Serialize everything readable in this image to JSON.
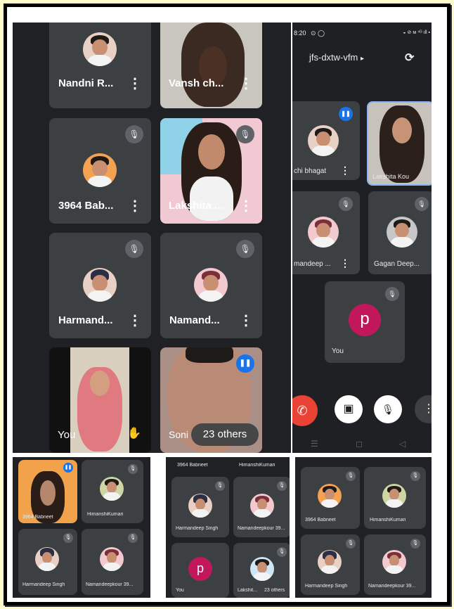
{
  "main": {
    "tiles": [
      {
        "name": "Nandni R...",
        "muted": false
      },
      {
        "name": "Vansh ch...",
        "muted": false
      },
      {
        "name": "3964 Bab...",
        "muted": true
      },
      {
        "name": "Lakshita ...",
        "muted": true
      },
      {
        "name": "Harmand...",
        "muted": true
      },
      {
        "name": "Namand...",
        "muted": true
      },
      {
        "name": "You",
        "muted": false
      },
      {
        "name": "Soni",
        "muted": false
      }
    ],
    "others_label": "23 others",
    "menu_glyph": "⋮",
    "mic_off_glyph": "🎙",
    "talk_glyph": "❚❚",
    "raise_hand_glyph": "✋"
  },
  "phone": {
    "status": {
      "time": "8:20",
      "icons_left": "⊙ ◯",
      "icons_right": "◒ ⊘ ᴍ ⁴ᴳ ıll ▪"
    },
    "meeting_code": "jfs-dxtw-vfm",
    "code_caret": "▸",
    "switch_camera_glyph": "⟳",
    "tiles": [
      {
        "name": "chi bhagat",
        "muted": false
      },
      {
        "name": "Lakshita Kou",
        "muted": false
      },
      {
        "name": "mandeep ...",
        "muted": true
      },
      {
        "name": "Gagan Deep...",
        "muted": true
      }
    ],
    "self": {
      "initial": "p",
      "label": "You"
    },
    "controls": {
      "end_call": "✆",
      "camera_off": "▣",
      "mic_off": "🎙",
      "more": "⋮"
    },
    "nav": {
      "menu": "☰",
      "home": "◻",
      "back": "◁"
    }
  },
  "bottom_left": {
    "tiles": [
      {
        "name": "3964 Babneet",
        "muted": false
      },
      {
        "name": "HimanshiKumari",
        "muted": true
      },
      {
        "name": "Harmandeep Singh",
        "muted": true
      },
      {
        "name": "Namandeepkour 39...",
        "muted": true
      }
    ]
  },
  "bottom_mid": {
    "top_labels": [
      "3964 Babneet",
      "HimanshiKumari"
    ],
    "tiles": [
      {
        "name": "Harmandeep Singh",
        "muted": true
      },
      {
        "name": "Namandeepkour 39...",
        "muted": true
      },
      {
        "name": "You",
        "initial": "p",
        "muted": false
      },
      {
        "name": "Lakshit...",
        "muted": true
      }
    ],
    "others_label": "23 others"
  },
  "bottom_right": {
    "tiles": [
      {
        "name": "3964 Babneet",
        "muted": true
      },
      {
        "name": "HimanshiKumari",
        "muted": true
      },
      {
        "name": "Harmandeep Singh",
        "muted": true
      },
      {
        "name": "Namandeepkour 39...",
        "muted": true
      }
    ]
  },
  "colors": {
    "background": "#fffbcc",
    "panel": "#202124",
    "tile": "#3c4043",
    "accent_blue": "#1a73e8",
    "end_call": "#ea4335",
    "avatar_p": "#c2185b"
  }
}
